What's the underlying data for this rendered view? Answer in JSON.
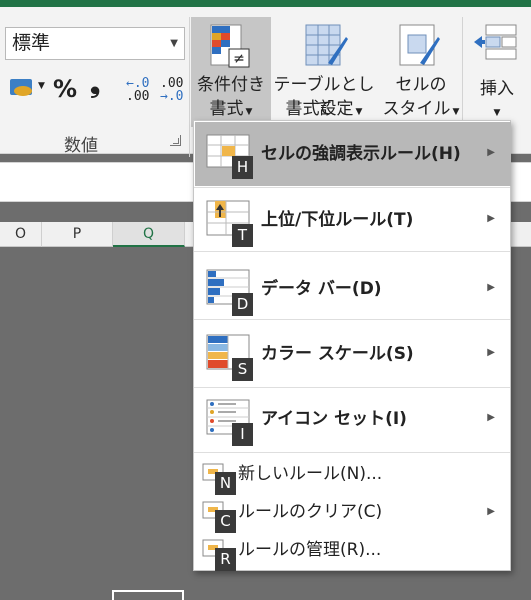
{
  "ribbon": {
    "number_format": {
      "value": "標準"
    },
    "number_group_label": "数値",
    "percent_glyph": "%",
    "comma_glyph": "❟",
    "dec_increase": {
      "top": "←.0",
      "bottom": ".00"
    },
    "dec_decrease": {
      "top": ".00",
      "bottom": "→.0"
    },
    "conditional_formatting": {
      "line1": "条件付き",
      "line2": "書式"
    },
    "format_as_table": {
      "line1": "テーブルとして",
      "line2": "書式設定"
    },
    "cell_styles": {
      "line1": "セルの",
      "line2": "スタイル"
    },
    "insert": {
      "label": "挿入"
    }
  },
  "columns": [
    "O",
    "P",
    "Q"
  ],
  "menu": {
    "items": [
      {
        "label": "セルの強調表示ルール(H)",
        "keytip": "H",
        "submenu": true
      },
      {
        "label": "上位/下位ルール(T)",
        "keytip": "T",
        "submenu": true
      },
      {
        "label": "データ バー(D)",
        "keytip": "D",
        "submenu": true
      },
      {
        "label": "カラー スケール(S)",
        "keytip": "S",
        "submenu": true
      },
      {
        "label": "アイコン セット(I)",
        "keytip": "I",
        "submenu": true
      }
    ],
    "small_items": [
      {
        "label": "新しいルール(N)...",
        "keytip": "N",
        "submenu": false
      },
      {
        "label": "ルールのクリア(C)",
        "keytip": "C",
        "submenu": true
      },
      {
        "label": "ルールの管理(R)...",
        "keytip": "R",
        "submenu": false
      }
    ]
  },
  "colors": {
    "accent": "#217346",
    "highlight": "#b8b8b8",
    "keytip_bg": "#3a3a3a"
  }
}
